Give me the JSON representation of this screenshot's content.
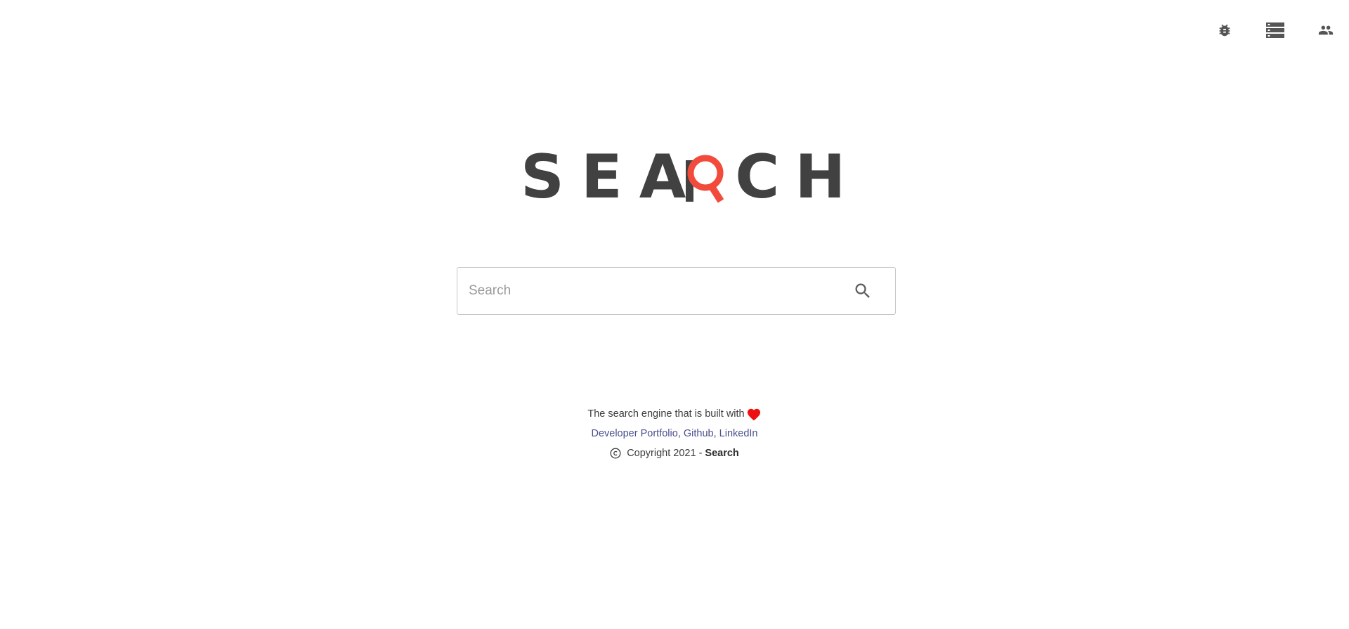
{
  "header": {
    "icons": [
      {
        "name": "bug-report-icon",
        "label": ""
      },
      {
        "name": "storage-icon",
        "label": ""
      },
      {
        "name": "people-icon",
        "label": ""
      }
    ]
  },
  "logo": {
    "letters": [
      "S",
      "E",
      "A",
      "R",
      "C",
      "H"
    ],
    "text_color": "#414141",
    "accent_color": "#f24b3b",
    "accent_icon": "magnifier-q-icon"
  },
  "search": {
    "placeholder": "Search",
    "value": "",
    "button_icon": "search-icon"
  },
  "footer": {
    "tagline": "The search engine that is built with",
    "heart_icon": "heart-icon",
    "heart_color": "#ee1111",
    "links": [
      {
        "label": "Developer Portfolio"
      },
      {
        "label": "Github"
      },
      {
        "label": "LinkedIn"
      }
    ],
    "separator": ", ",
    "copyright_text": "Copyright 2021 -",
    "brand": "Search"
  }
}
